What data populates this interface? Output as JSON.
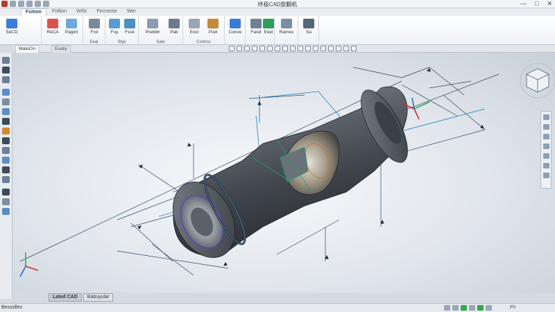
{
  "window": {
    "title": "终极CAD旋翻机",
    "controls": [
      "—",
      "□",
      "✕"
    ]
  },
  "ribbon_tabs": [
    {
      "label": "Fsitom",
      "active": true
    },
    {
      "label": "Fnltion",
      "active": false
    },
    {
      "label": "Wrliz",
      "active": false
    },
    {
      "label": "Fecroctor",
      "active": false
    },
    {
      "label": "Wer",
      "active": false
    }
  ],
  "ribbon": {
    "groups": [
      {
        "label": "",
        "buttons": [
          "SeCD"
        ]
      },
      {
        "label": "",
        "buttons": [
          "ReCA",
          "Pagint"
        ]
      },
      {
        "label": "Eeal",
        "buttons": [
          "Frol"
        ]
      },
      {
        "label": "Stye",
        "buttons": [
          "Fuy",
          "Fsve"
        ]
      },
      {
        "label": "Sate",
        "buttons": [
          "Prebblr",
          "Pab"
        ]
      },
      {
        "label": "Contrsc",
        "buttons": [
          "Eoct",
          "Pvel"
        ]
      },
      {
        "label": "",
        "buttons": [
          "Conve"
        ]
      },
      {
        "label": "",
        "buttons": [
          "Faod",
          "Eeel"
        ]
      },
      {
        "label": "",
        "buttons": [
          "Rarries"
        ]
      },
      {
        "label": "",
        "buttons": [
          "Sa"
        ]
      }
    ]
  },
  "document_tabs": [
    {
      "label": "MateCin",
      "active": true
    },
    {
      "label": "Eoaliy",
      "active": false
    }
  ],
  "bottom_tabs": [
    {
      "label": "Lated CAD",
      "active": true
    },
    {
      "label": "Babuyular",
      "active": false
    }
  ],
  "statusbar": {
    "text": "Bessidles",
    "right_text": "Pir"
  },
  "icons": {
    "viewcube": "viewcube-icon",
    "triad": "xyz-triad-icon"
  },
  "colors": {
    "accent": "#1f3f78",
    "axis_x": "#d62828",
    "axis_y": "#2faa4b",
    "axis_z": "#1f6fd6",
    "sketch": "#20a070",
    "dimension": "#1a5fb4"
  }
}
